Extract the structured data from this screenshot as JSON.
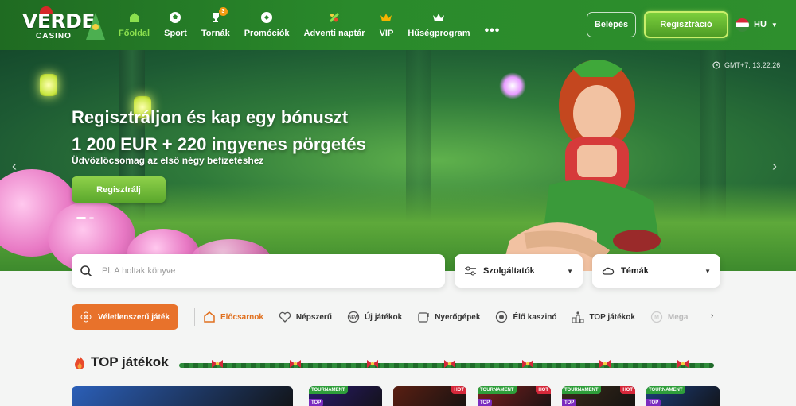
{
  "brand": {
    "name": "VERDE",
    "sub": "CASINO"
  },
  "nav": [
    {
      "label": "Főoldal",
      "icon": "home-icon",
      "active": true
    },
    {
      "label": "Sport",
      "icon": "soccer-ball-icon"
    },
    {
      "label": "Tornák",
      "icon": "trophy-icon",
      "badge": "3"
    },
    {
      "label": "Promóciók",
      "icon": "gift-icon"
    },
    {
      "label": "Adventi naptár",
      "icon": "advent-icon"
    },
    {
      "label": "VIP",
      "icon": "crown-icon"
    },
    {
      "label": "Hűségprogram",
      "icon": "loyalty-crown-icon"
    }
  ],
  "nav_more": "•••",
  "header": {
    "login_label": "Belépés",
    "register_label": "Regisztráció",
    "language": "HU"
  },
  "hero": {
    "title_line1": "Regisztráljon és kap egy bónuszt",
    "title_line2": "1 200 EUR + 220 ingyenes pörgetés",
    "subtitle": "Üdvözlőcsomag az első négy befizetéshez",
    "cta_label": "Regisztrálj",
    "time": "GMT+7, 13:22:26"
  },
  "search": {
    "placeholder": "Pl. A holtak könyve"
  },
  "filters": {
    "providers_label": "Szolgáltatók",
    "themes_label": "Témák"
  },
  "random_game_label": "Véletlenszerű játék",
  "categories": [
    {
      "label": "Előcsarnok",
      "icon": "lobby-icon",
      "active": true
    },
    {
      "label": "Népszerű",
      "icon": "heart-icon"
    },
    {
      "label": "Új játékok",
      "icon": "new-icon"
    },
    {
      "label": "Nyerőgépek",
      "icon": "slot-icon"
    },
    {
      "label": "Élő kaszinó",
      "icon": "live-icon"
    },
    {
      "label": "TOP játékok",
      "icon": "podium-icon"
    },
    {
      "label": "Mega",
      "icon": "mega-icon",
      "faded": true
    }
  ],
  "section": {
    "title": "TOP játékok"
  },
  "game_tiles": [
    {
      "tag": "",
      "hot": false,
      "top": false,
      "color": "#2b5fb8"
    },
    {
      "tag": "TOURNAMENT",
      "hot": false,
      "top": true,
      "color": "#2a1a6e"
    },
    {
      "tag": "",
      "hot": true,
      "top": false,
      "color": "#5a1f12"
    },
    {
      "tag": "TOURNAMENT",
      "hot": true,
      "top": true,
      "color": "#7b1f1f"
    },
    {
      "tag": "TOURNAMENT",
      "hot": true,
      "top": true,
      "color": "#3a2a1a"
    },
    {
      "tag": "TOURNAMENT",
      "hot": false,
      "top": true,
      "color": "#1c3d7a"
    }
  ],
  "tile_labels": {
    "hot": "HOT",
    "top": "TOP"
  },
  "colors": {
    "header": "#2a8a2b",
    "accent_green": "#8be04e",
    "orange": "#e8722b"
  }
}
